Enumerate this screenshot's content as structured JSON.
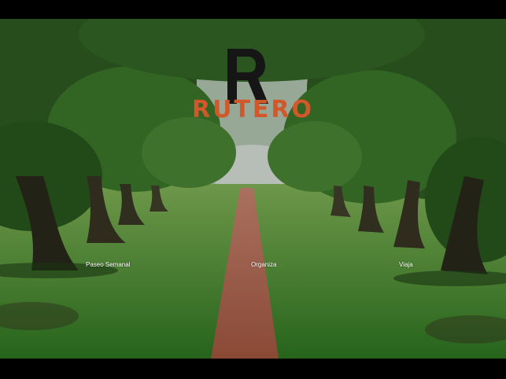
{
  "app": {
    "brand": "RUTERO"
  },
  "nav": {
    "items": [
      {
        "label": "Paseo Semanal"
      },
      {
        "label": "Organiza"
      },
      {
        "label": "Viaja"
      }
    ]
  },
  "colors": {
    "brand": "#d0582a",
    "background": "#000000",
    "path": "#b86a4f"
  },
  "icons": {
    "logo": "rutero-r-logo-icon"
  }
}
